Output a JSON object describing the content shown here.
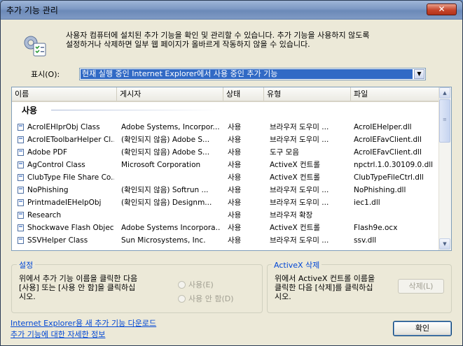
{
  "window": {
    "title": "추가 기능 관리",
    "close_label": "✕"
  },
  "intro": {
    "icon": "gear-checklist-icon",
    "text_line1": "사용자 컴퓨터에 설치된 추가 기능을 확인 및 관리할 수 있습니다. 추가 기능을 사용하지 않도록",
    "text_line2": "설정하거나 삭제하면 일부 웹 페이지가 올바르게 작동하지 않을 수 있습니다."
  },
  "show": {
    "label": "표시(O):",
    "selected": "현재 실행 중인 Internet Explorer에서 사용 중인 추가 기능"
  },
  "table": {
    "columns": [
      "이름",
      "게시자",
      "상태",
      "유형",
      "파일"
    ],
    "group": "사용",
    "rows": [
      {
        "name": "AcroIEHlprObj Class",
        "publisher": "Adobe Systems, Incorpor...",
        "status": "사용",
        "type": "브라우저 도우미 ...",
        "file": "AcroIEHelper.dll"
      },
      {
        "name": "AcroIEToolbarHelper Cl...",
        "publisher": "(확인되지 않음) Adobe S...",
        "status": "사용",
        "type": "브라우저 도우미 ...",
        "file": "AcroIEFavClient.dll"
      },
      {
        "name": "Adobe PDF",
        "publisher": "(확인되지 않음) Adobe S...",
        "status": "사용",
        "type": "도구 모음",
        "file": "AcroIEFavClient.dll"
      },
      {
        "name": "AgControl Class",
        "publisher": "Microsoft Corporation",
        "status": "사용",
        "type": "ActiveX 컨트롤",
        "file": "npctrl.1.0.30109.0.dll"
      },
      {
        "name": "ClubType File Share Co...",
        "publisher": "",
        "status": "사용",
        "type": "ActiveX 컨트롤",
        "file": "ClubTypeFileCtrl.dll"
      },
      {
        "name": "NoPhishing",
        "publisher": "(확인되지 않음) Softrun ...",
        "status": "사용",
        "type": "브라우저 도우미 ...",
        "file": "NoPhishing.dll"
      },
      {
        "name": "PrintmadeIEHelpObj",
        "publisher": "(확인되지 않음) Designm...",
        "status": "사용",
        "type": "브라우저 도우미 ...",
        "file": "iec1.dll"
      },
      {
        "name": "Research",
        "publisher": "",
        "status": "사용",
        "type": "브라우저 확장",
        "file": ""
      },
      {
        "name": "Shockwave Flash Object",
        "publisher": "Adobe Systems Incorpora...",
        "status": "사용",
        "type": "ActiveX 컨트롤",
        "file": "Flash9e.ocx"
      },
      {
        "name": "SSVHelper Class",
        "publisher": "Sun Microsystems, Inc.",
        "status": "사용",
        "type": "브라우저 도우미 ...",
        "file": "ssv.dll"
      }
    ]
  },
  "settings": {
    "title": "설정",
    "text_line1": "위에서 추가 기능 이름을 클릭한 다음",
    "text_line2": "[사용] 또는 [사용 안 함]을 클릭하십",
    "text_line3": "시오.",
    "enable_label": "사용(E)",
    "disable_label": "사용 안 함(D)"
  },
  "activex": {
    "title": "ActiveX 삭제",
    "text_line1": "위에서 ActiveX 컨트롤 이름을",
    "text_line2": "클릭한 다음 [삭제]를 클릭하십",
    "text_line3": "시오.",
    "delete_label": "삭제(L)"
  },
  "links": {
    "download": "Internet Explorer용 새 추가 기능 다운로드",
    "more_info": "추가 기능에 대한 자세한 정보"
  },
  "ok_label": "확인"
}
